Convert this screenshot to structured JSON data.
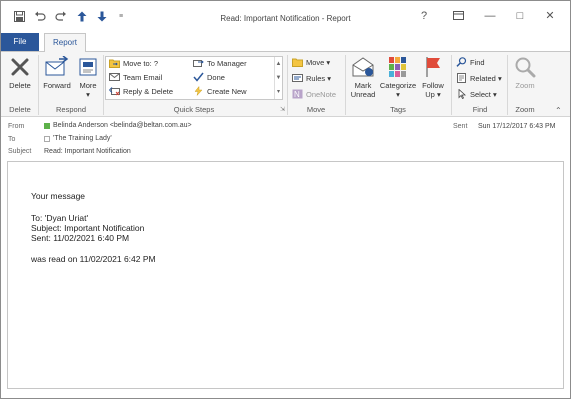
{
  "window": {
    "title": "Read: Important Notification  -  Report",
    "help": "?",
    "restore_ribbon": "▭",
    "minimize": "—",
    "maximize": "□",
    "close": "✕"
  },
  "qat": {
    "save_icon": "save-icon",
    "undo_icon": "undo-icon",
    "redo_icon": "redo-icon",
    "up_icon": "up-arrow-icon",
    "down_icon": "down-arrow-icon",
    "customize_icon": "customize-icon"
  },
  "tabs": {
    "file": "File",
    "report": "Report"
  },
  "ribbon": {
    "delete": {
      "label": "Delete",
      "group": "Delete"
    },
    "respond": {
      "forward": "Forward",
      "more": "More",
      "more_arrow": "▾",
      "group": "Respond"
    },
    "quick_steps": {
      "items": [
        "Move to: ?",
        "Team Email",
        "Reply & Delete",
        "To Manager",
        "Done",
        "Create New"
      ],
      "group": "Quick Steps"
    },
    "move": {
      "move": "Move",
      "rules": "Rules",
      "onenote": "OneNote",
      "group": "Move"
    },
    "tags": {
      "mark_unread_1": "Mark",
      "mark_unread_2": "Unread",
      "categorize": "Categorize",
      "categorize_arrow": "▾",
      "follow_up_1": "Follow",
      "follow_up_2": "Up",
      "group": "Tags"
    },
    "find": {
      "find": "Find",
      "related": "Related",
      "select": "Select",
      "group": "Find"
    },
    "zoom": {
      "zoom": "Zoom",
      "group": "Zoom"
    }
  },
  "header": {
    "from_label": "From",
    "from_value": "Belinda Anderson <belinda@beltan.com.au>",
    "to_label": "To",
    "to_value": "'The Training Lady'",
    "subject_label": "Subject",
    "subject_value": "Read: Important Notification",
    "sent_label": "Sent",
    "sent_value": "Sun 17/12/2017 6:43 PM"
  },
  "body": {
    "line1": "Your message",
    "line2": "To: 'Dyan Uriat'",
    "line3": "Subject: Important Notification",
    "line4": "Sent:  11/02/2021 6:40 PM",
    "line5": "was read on 11/02/2021  6:42 PM"
  },
  "colors": {
    "accent": "#2b579a",
    "ribbon_bg": "#f5f5f5",
    "presence_green": "#5db14a",
    "flag_red": "#e04b3a"
  }
}
